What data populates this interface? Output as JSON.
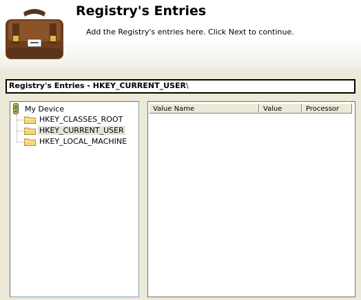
{
  "header": {
    "title": "Registry's Entries",
    "subtitle": "Add the Registry's entries here. Click Next to continue.",
    "icon": "satchel-icon"
  },
  "path_bar": {
    "prefix": "Registry's Entries - HKEY_CURRENT_USER",
    "suffix": "\\"
  },
  "tree": {
    "root": {
      "label": "My Device",
      "icon": "device-icon"
    },
    "items": [
      {
        "label": "HKEY_CLASSES_ROOT",
        "icon": "folder-icon",
        "selected": false
      },
      {
        "label": "HKEY_CURRENT_USER",
        "icon": "folder-icon",
        "selected": true
      },
      {
        "label": "HKEY_LOCAL_MACHINE",
        "icon": "folder-icon",
        "selected": false
      }
    ]
  },
  "list": {
    "columns": [
      "Value Name",
      "Value",
      "Processor"
    ],
    "rows": []
  },
  "colors": {
    "background": "#ece9d8",
    "selection": "#e4e2da",
    "folder": "#f5d77a"
  }
}
